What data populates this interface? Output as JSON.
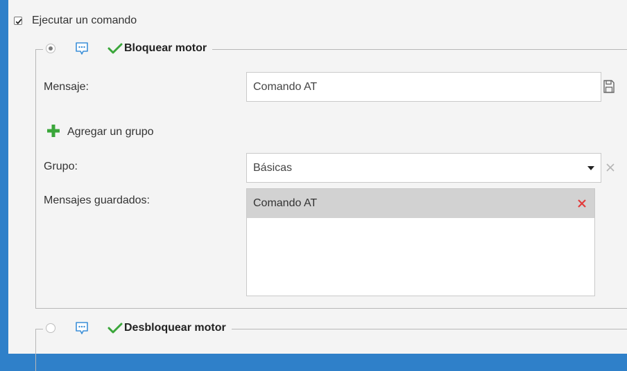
{
  "colors": {
    "background": "#2f80c9",
    "panel": "#f4f4f4",
    "check_green": "#3aa63a",
    "delete_red": "#e23b3b",
    "selected_row": "#d2d2d2"
  },
  "execute_command": {
    "label": "Ejecutar un comando",
    "checked": true
  },
  "commands": [
    {
      "title": "Bloquear motor",
      "selected": true,
      "form": {
        "message_label": "Mensaje:",
        "message_value": "Comando AT",
        "add_group_label": "Agregar un grupo",
        "group_label": "Grupo:",
        "group_value": "Básicas",
        "saved_messages_label": "Mensajes guardados:",
        "saved_messages": [
          "Comando AT"
        ]
      }
    },
    {
      "title": "Desbloquear motor",
      "selected": false
    }
  ],
  "icons": {
    "checkbox": "checkbox-checked-icon",
    "message": "message-bubble-icon",
    "check": "checkmark-icon",
    "save": "floppy-save-icon",
    "add": "plus-icon",
    "dropdown": "caret-down-icon",
    "clear": "x-clear-icon",
    "delete": "x-delete-icon"
  }
}
